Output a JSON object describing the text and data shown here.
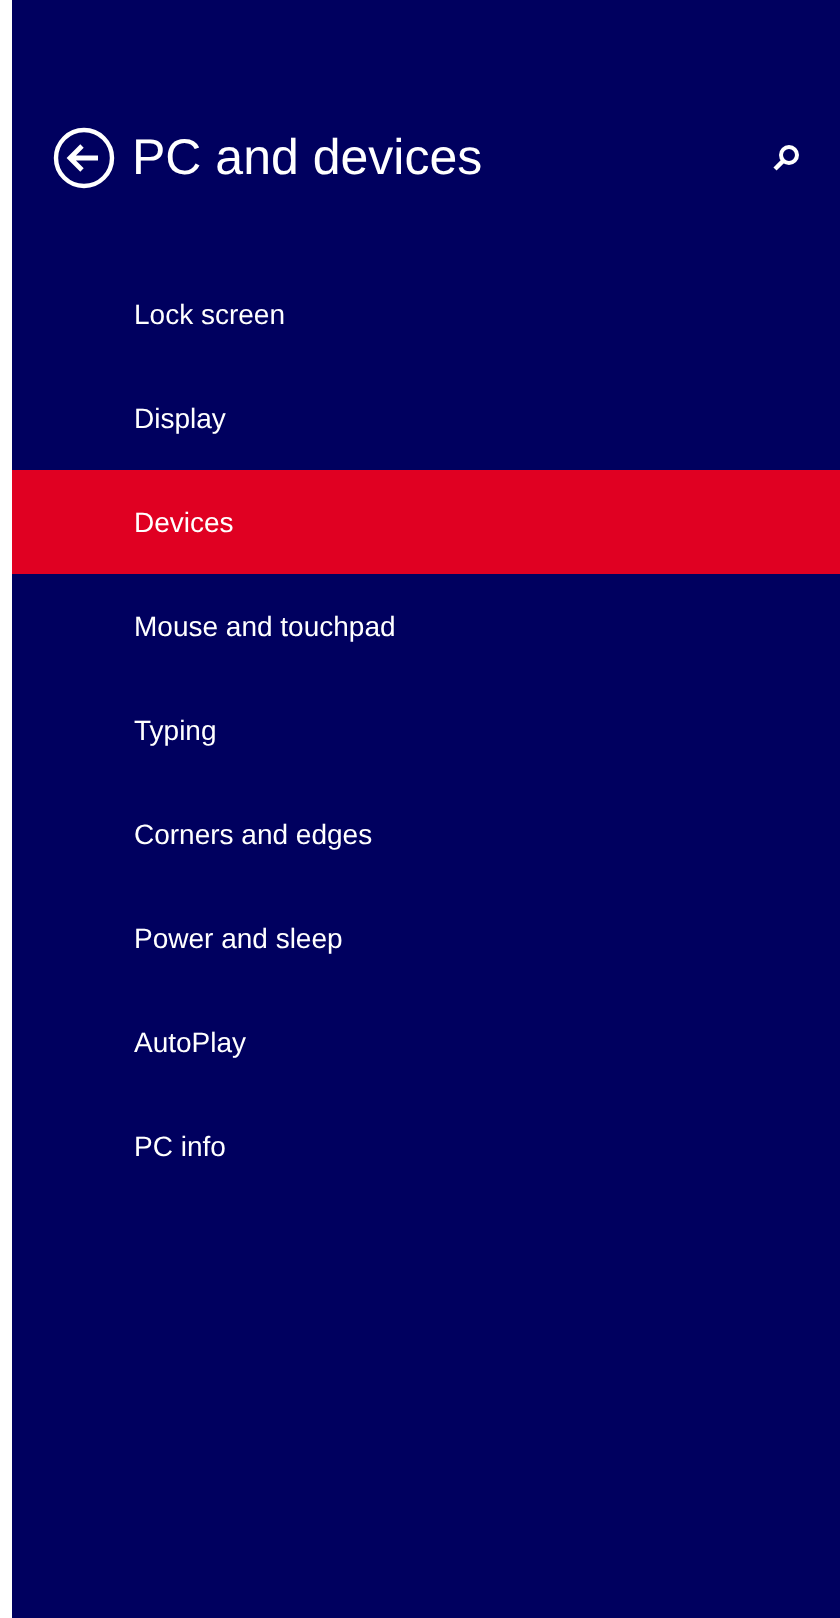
{
  "header": {
    "title": "PC and devices"
  },
  "items": [
    {
      "label": "Lock screen",
      "selected": false
    },
    {
      "label": "Display",
      "selected": false
    },
    {
      "label": "Devices",
      "selected": true
    },
    {
      "label": "Mouse and touchpad",
      "selected": false
    },
    {
      "label": "Typing",
      "selected": false
    },
    {
      "label": "Corners and edges",
      "selected": false
    },
    {
      "label": "Power and sleep",
      "selected": false
    },
    {
      "label": "AutoPlay",
      "selected": false
    },
    {
      "label": "PC info",
      "selected": false
    }
  ]
}
